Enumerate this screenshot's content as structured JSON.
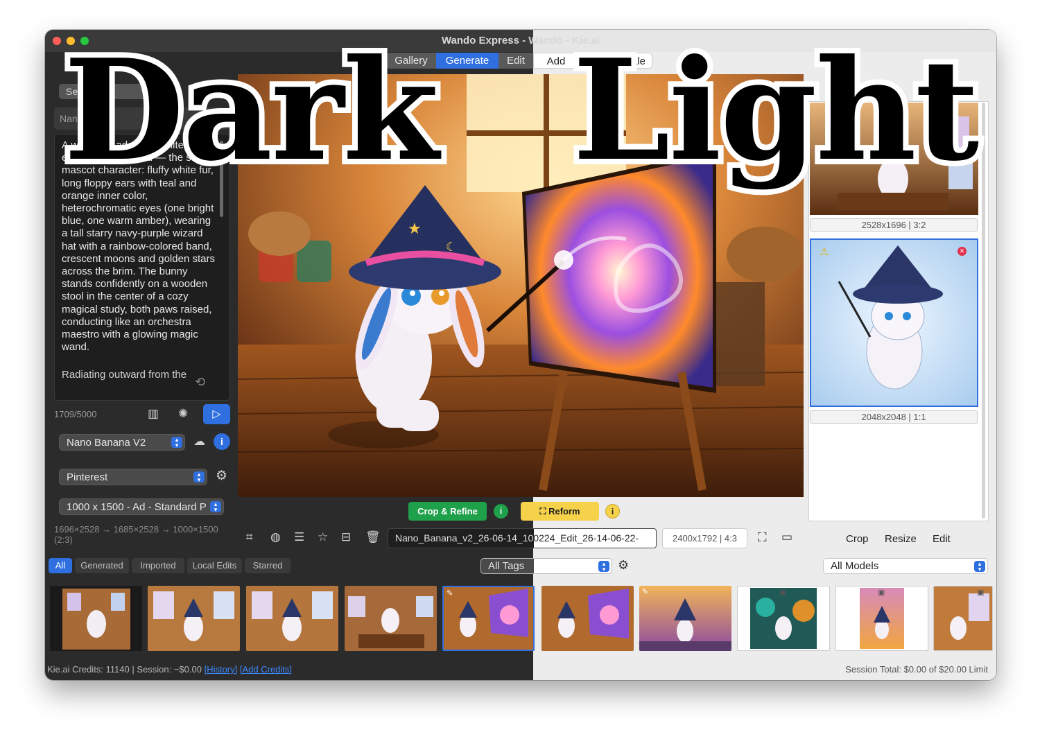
{
  "overlay": {
    "dark_word": "Dark",
    "light_word": "Light"
  },
  "window": {
    "title": "Wando Express - Wando - Kie.ai"
  },
  "tabs": [
    "Gallery",
    "Generate",
    "Edit",
    "Add",
    "ale"
  ],
  "left_panel": {
    "preset_button": "Se   et",
    "model_name_field": "Nan      ve Blan",
    "prompt_text": "A w                    bo                   g of adorable white lop-eared bunny wizard — the same mascot character: fluffy white fur, long floppy ears with teal and orange inner color, heterochromatic eyes (one bright blue, one warm amber), wearing a tall starry navy-purple wizard hat with a rainbow-colored band, crescent moons and golden stars across the brim. The bunny stands confidently on a wooden stool in the center of a cozy magical study, both paws raised, conducting like an orchestra maestro with a glowing magic wand.",
    "prompt_tail": "Radiating outward from the",
    "char_count": "1709/5000",
    "model_select": "Nano Banana V2",
    "style_select": "Pinterest",
    "size_select": "1000 x 1500 - Ad - Standard P",
    "resize_chain": "1696×2528 → 1685×2528 → 1000×1500 (2:3)"
  },
  "actions": {
    "crop_refine": "Crop & Refine",
    "reform": "Reform",
    "info": "i"
  },
  "filename": "Nano_Banana_v2_26-06-14_100224_Edit_26-14-06-22-",
  "image_dims": "2400x1792 | 4:3",
  "right_actions": {
    "crop": "Crop",
    "resize": "Resize",
    "edit": "Edit"
  },
  "results": [
    {
      "label": "2528x1696 | 3:2"
    },
    {
      "label": "2048x2048 | 1:1"
    }
  ],
  "filters": {
    "tabs": [
      "All",
      "Generated",
      "Imported",
      "Local Edits",
      "Starred"
    ],
    "tags_select": "All Tags",
    "models_select": "All Models"
  },
  "status": {
    "credits": "Kie.ai Credits: 11140 | Session: ~$0.00",
    "history_link": "[History]",
    "add_credits_link": "[Add Credits]",
    "session_total": "Session Total: $0.00 of $20.00 Limit"
  },
  "colors": {
    "accent": "#2f6fe0",
    "green": "#1fa04a",
    "yellow": "#f6d24a",
    "dark_bg": "#2b2b2b",
    "light_bg": "#ececec"
  }
}
